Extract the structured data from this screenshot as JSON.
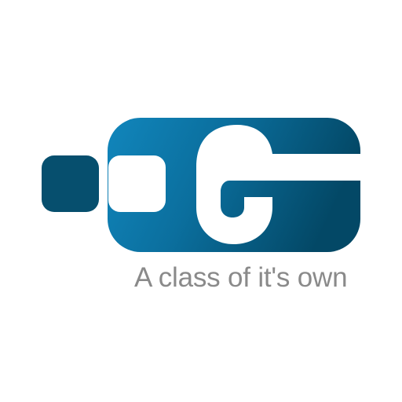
{
  "logo": {
    "icon": "brand-g-logo-icon",
    "tagline": "A class of it's own",
    "colors": {
      "square": "#064f6e",
      "gradient_start": "#1186bc",
      "gradient_end": "#034866",
      "tagline": "#8a8a8a",
      "background": "#ffffff"
    }
  }
}
